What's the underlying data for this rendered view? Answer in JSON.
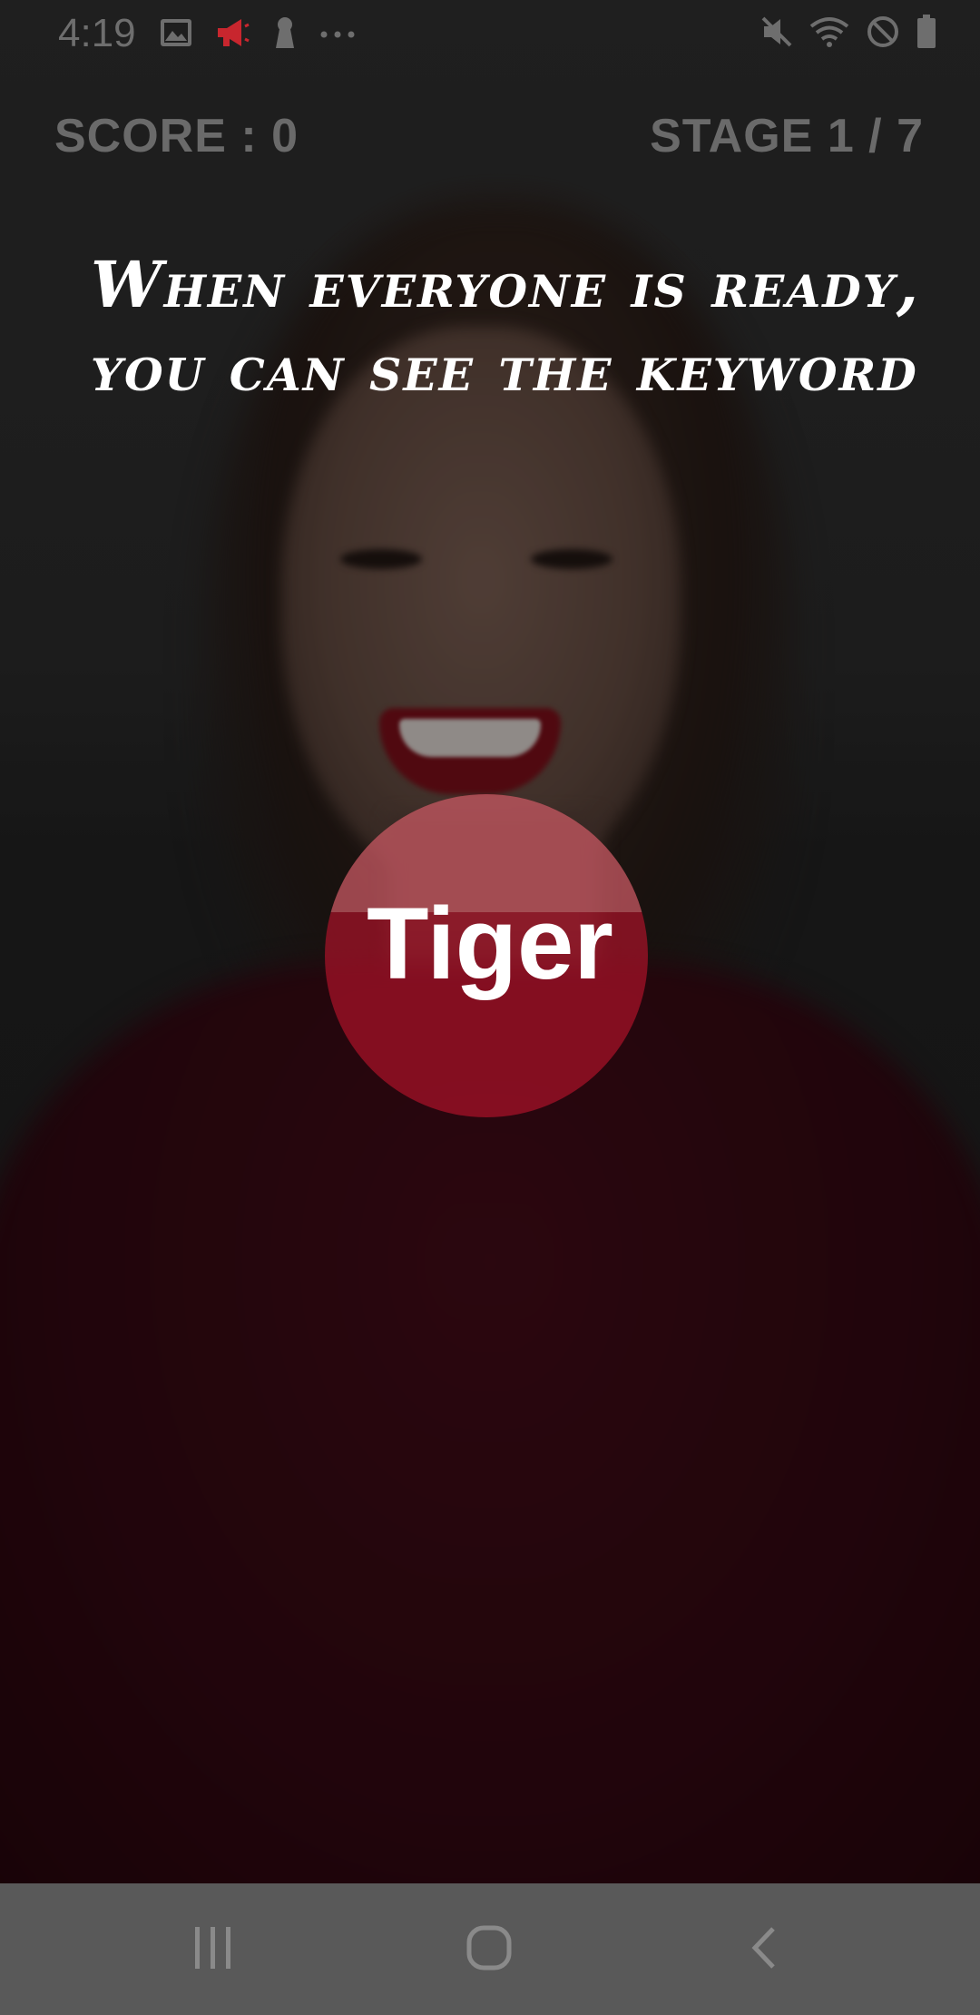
{
  "status_bar": {
    "time": "4:19",
    "left_icons": [
      "image-icon",
      "megaphone-icon",
      "keyhole-icon",
      "more-dots-icon"
    ],
    "right_icons": [
      "mute-icon",
      "wifi-icon",
      "do-not-disturb-icon",
      "battery-icon"
    ],
    "accent_color": "#c8262e"
  },
  "game_header": {
    "score": "SCORE : 0",
    "stage": "STAGE 1 / 7"
  },
  "instruction": {
    "line1": "When everyone is ready,",
    "line2": "you can see the keyword"
  },
  "keyword": {
    "text": "Tiger",
    "circle_color": "#be142d"
  },
  "nav_bar": {
    "buttons": [
      "recent-apps-icon",
      "home-icon",
      "back-icon"
    ]
  }
}
